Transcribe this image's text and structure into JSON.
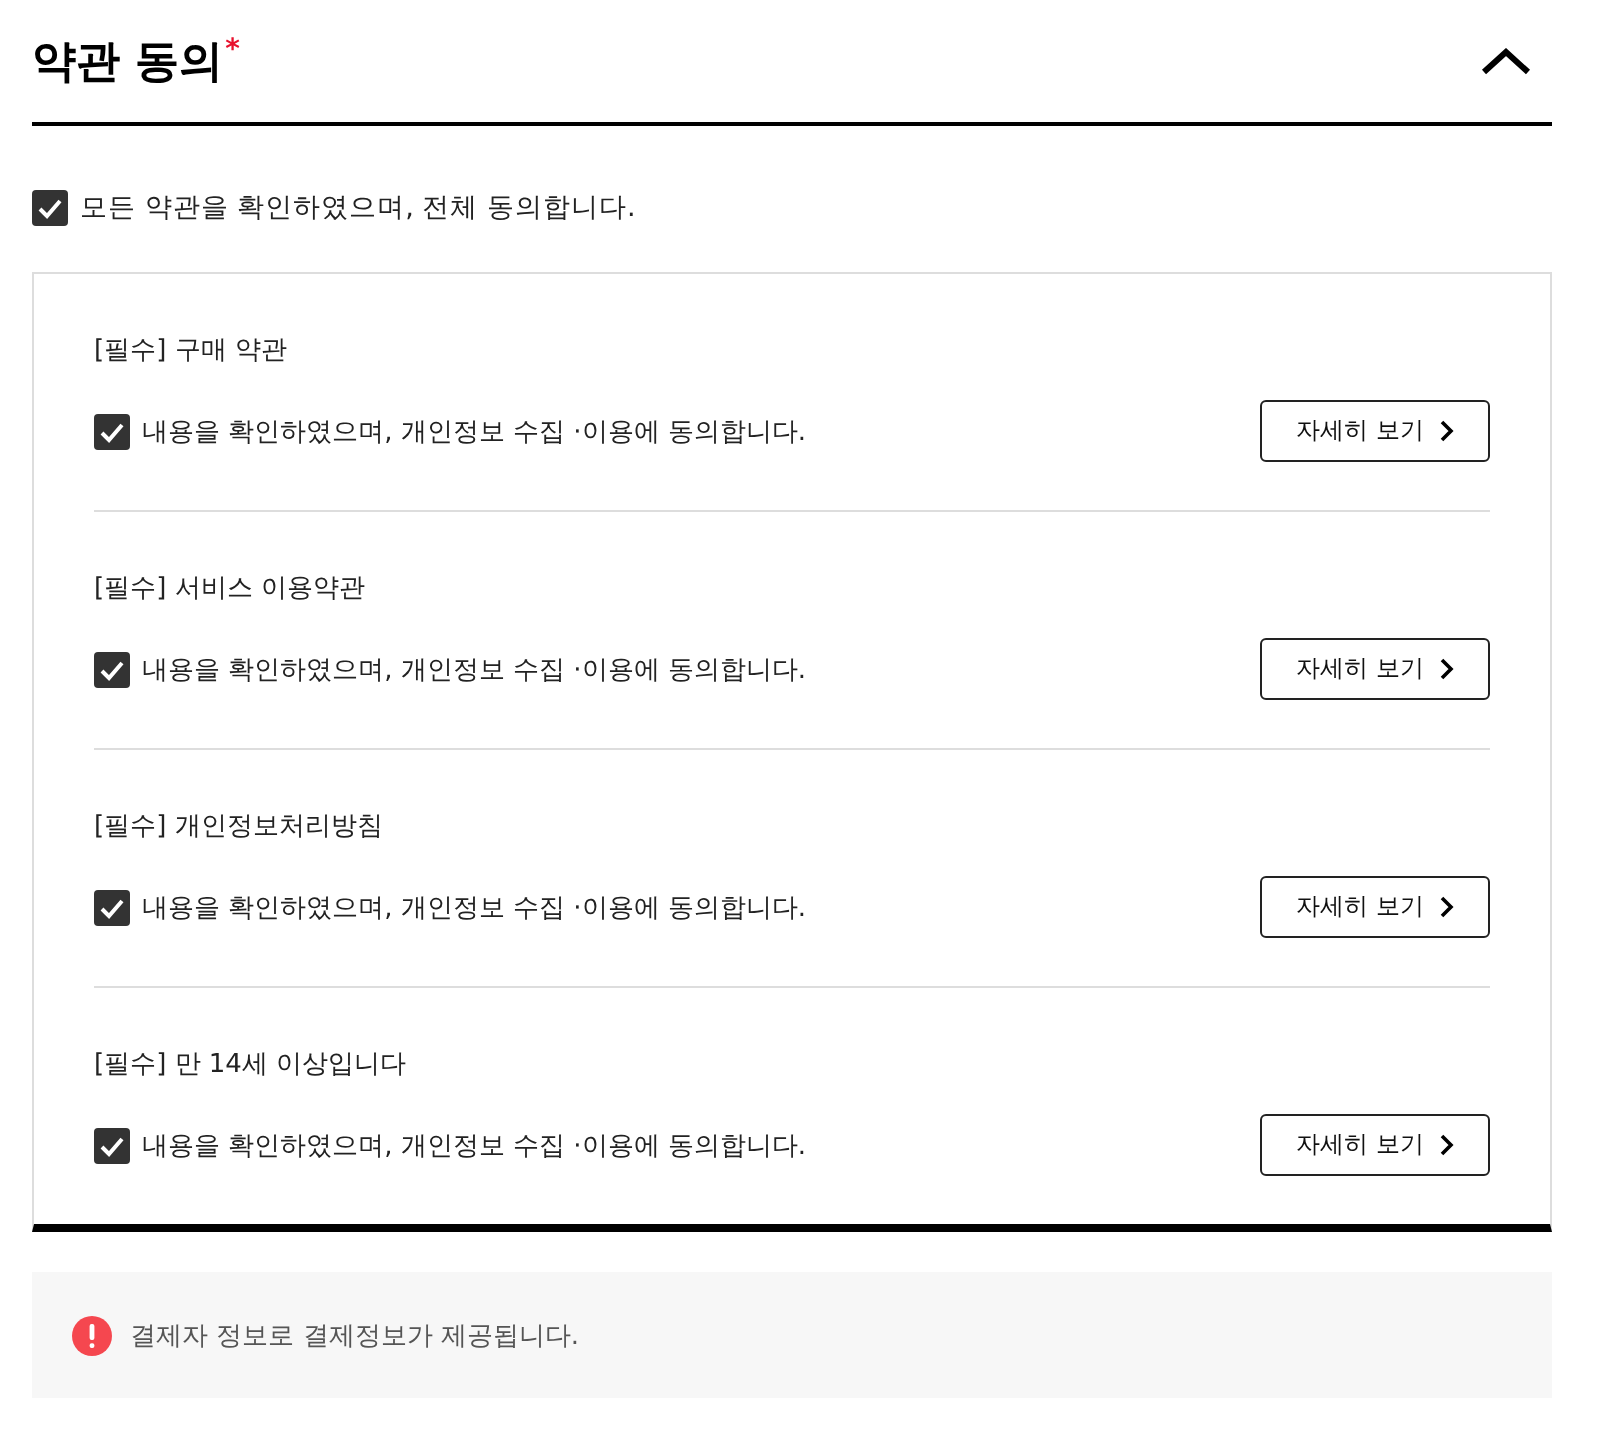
{
  "section": {
    "title": "약관 동의",
    "required_mark": "*",
    "expanded": true
  },
  "agree_all": {
    "label": "모든 약관을 확인하였으며, 전체 동의합니다.",
    "checked": true
  },
  "terms": [
    {
      "title": "[필수] 구매 약관",
      "label": "내용을 확인하였으며, 개인정보 수집 ·이용에 동의합니다.",
      "checked": true,
      "button": "자세히 보기"
    },
    {
      "title": "[필수] 서비스 이용약관",
      "label": "내용을 확인하였으며, 개인정보 수집 ·이용에 동의합니다.",
      "checked": true,
      "button": "자세히 보기"
    },
    {
      "title": "[필수] 개인정보처리방침",
      "label": "내용을 확인하였으며, 개인정보 수집 ·이용에 동의합니다.",
      "checked": true,
      "button": "자세히 보기"
    },
    {
      "title": "[필수] 만 14세 이상입니다",
      "label": "내용을 확인하였으며, 개인정보 수집 ·이용에 동의합니다.",
      "checked": true,
      "button": "자세히 보기"
    }
  ],
  "notice": {
    "text": "결제자 정보로 결제정보가 제공됩니다."
  }
}
